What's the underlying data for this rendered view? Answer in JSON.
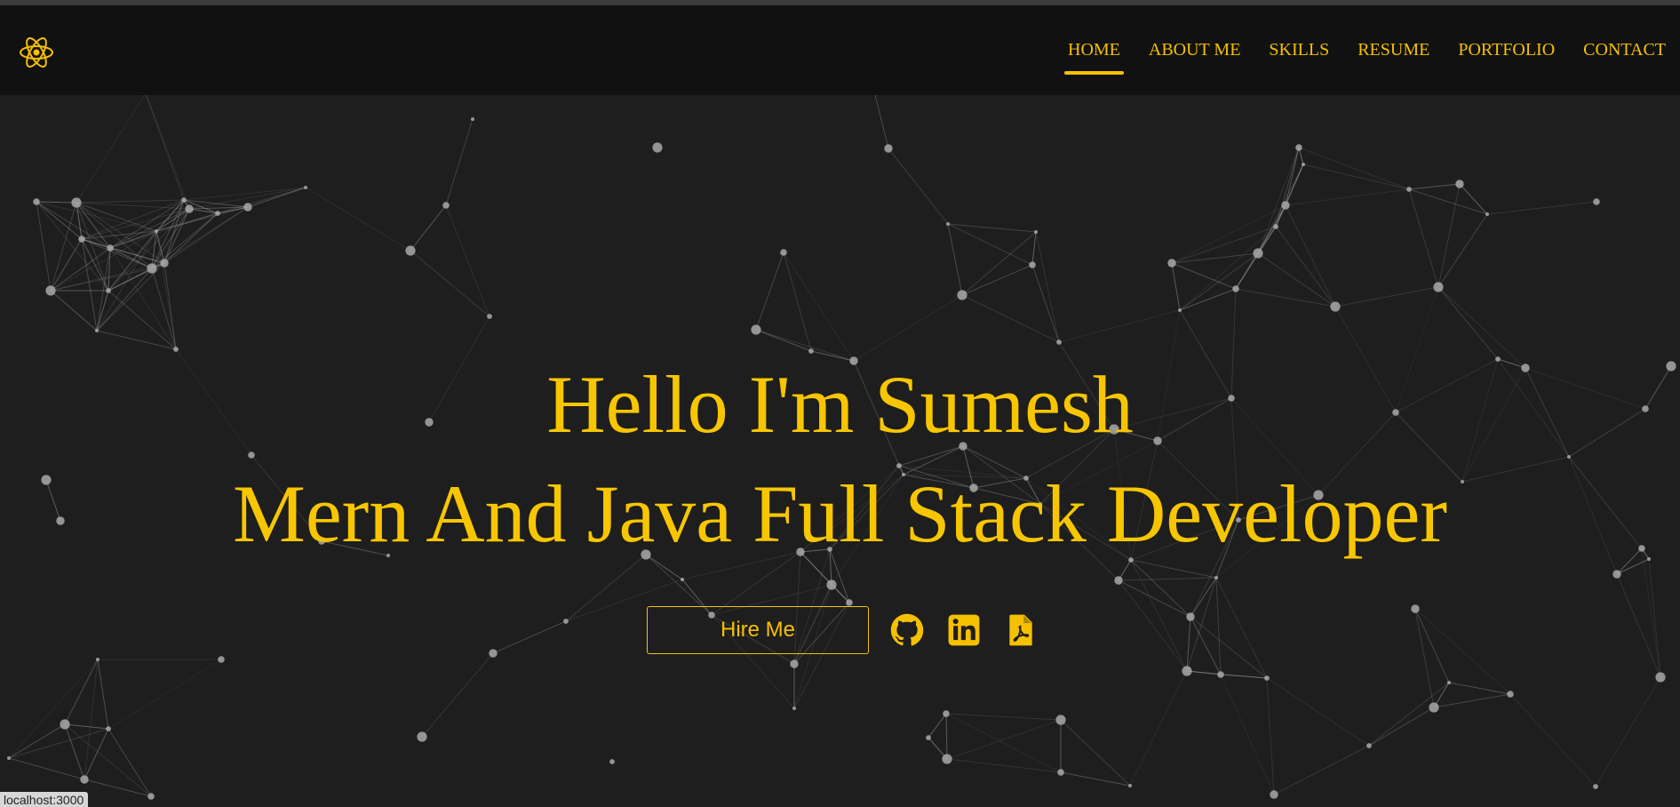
{
  "nav": {
    "items": [
      {
        "label": "HOME",
        "active": true
      },
      {
        "label": "ABOUT ME",
        "active": false
      },
      {
        "label": "SKILLS",
        "active": false
      },
      {
        "label": "RESUME",
        "active": false
      },
      {
        "label": "PORTFOLIO",
        "active": false
      },
      {
        "label": "CONTACT",
        "active": false
      }
    ],
    "logo_icon": "react-atom-icon"
  },
  "hero": {
    "title_line1": "Hello I'm Sumesh",
    "title_line2": "Mern And Java Full Stack Developer",
    "hire_label": "Hire Me",
    "social_icons": [
      "github-icon",
      "linkedin-icon",
      "pdf-resume-icon"
    ]
  },
  "status_bar": {
    "url": "localhost:3000"
  },
  "colors": {
    "accent": "#f5c000",
    "background": "#1e1e1e",
    "navbar": "#111111",
    "particles": "#a9a9a9"
  }
}
